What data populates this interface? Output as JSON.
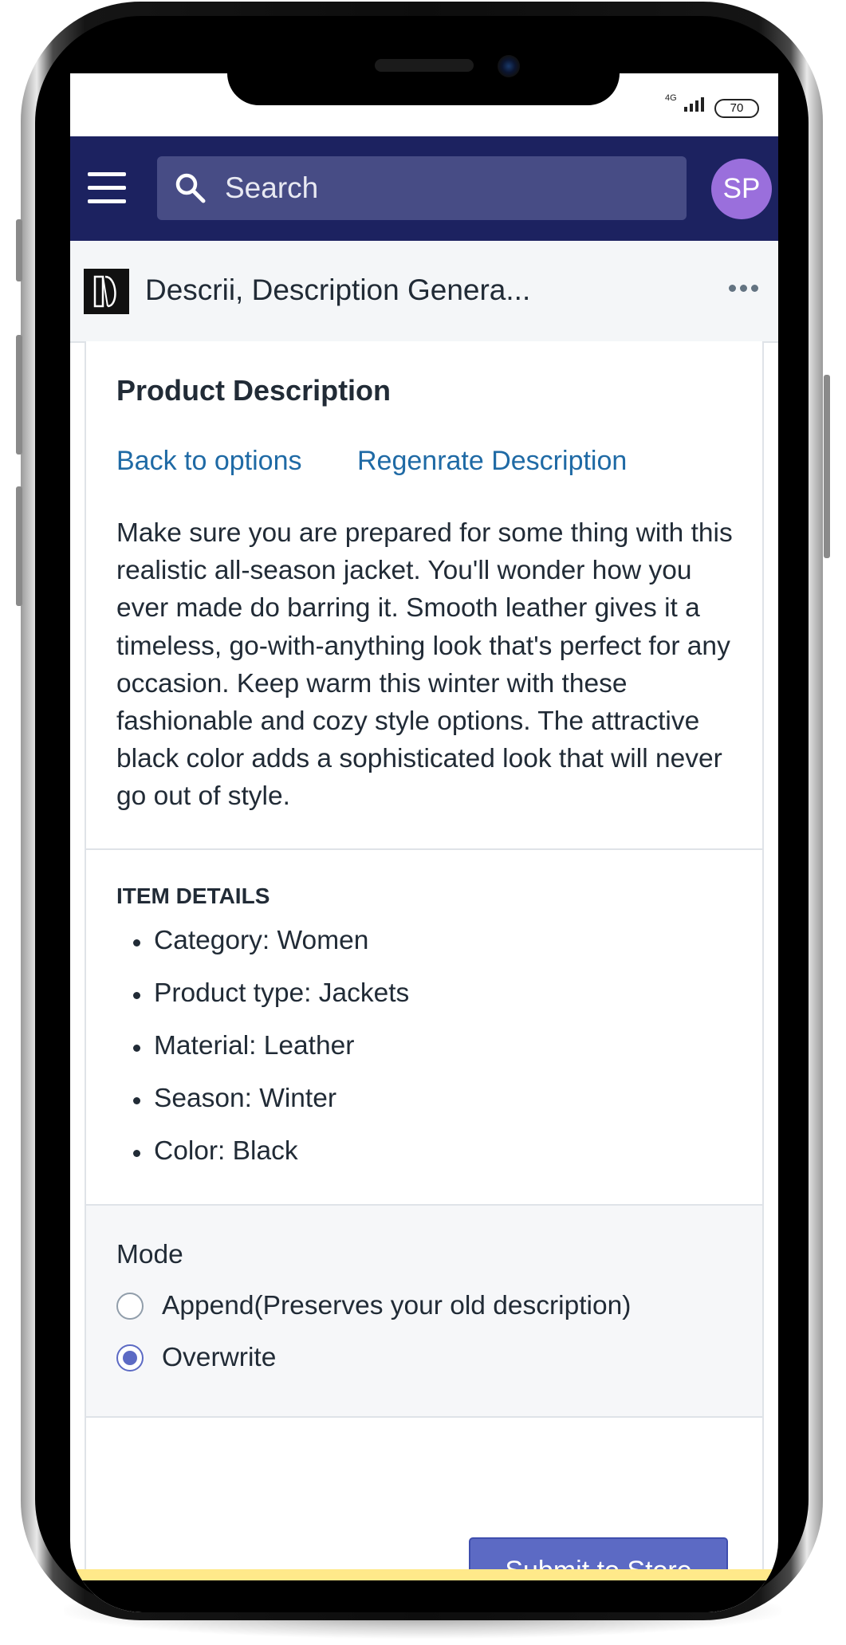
{
  "status_bar": {
    "network": "4G",
    "battery": "70"
  },
  "top_bar": {
    "search_placeholder": "Search",
    "avatar_initials": "SP"
  },
  "app_header": {
    "title": "Descrii, Description Genera..."
  },
  "product": {
    "title": "Product Description",
    "back_link": "Back to options",
    "regenerate_link": "Regenrate Description",
    "description": "Make sure you are prepared for some thing with this realistic all-season jacket. You'll wonder how you ever made do barring it. Smooth leather gives it a timeless, go-with-anything look that's perfect for any occasion. Keep warm this winter with these fashionable and cozy style options. The attractive black color adds a sophisticated look that will never go out of style."
  },
  "details": {
    "title": "ITEM DETAILS",
    "items": [
      "Category: Women",
      "Product type: Jackets",
      "Material: Leather",
      "Season: Winter",
      "Color: Black"
    ]
  },
  "mode": {
    "label": "Mode",
    "options": [
      {
        "label": "Append(Preserves your old description)",
        "selected": false
      },
      {
        "label": "Overwrite",
        "selected": true
      }
    ]
  },
  "actions": {
    "submit_label": "Submit to Store"
  },
  "colors": {
    "top_bar": "#1c2260",
    "search_bg": "#474c85",
    "avatar": "#9a6fdc",
    "link": "#1f6aa5",
    "primary_button": "#5c6ac4",
    "radio_selected": "#5c6ac4",
    "bottom_strip": "#ffe98a"
  },
  "icons": {
    "menu": "hamburger-icon",
    "search": "search-icon",
    "more": "more-horizontal-icon",
    "app_logo": "descrii-logo-icon"
  }
}
